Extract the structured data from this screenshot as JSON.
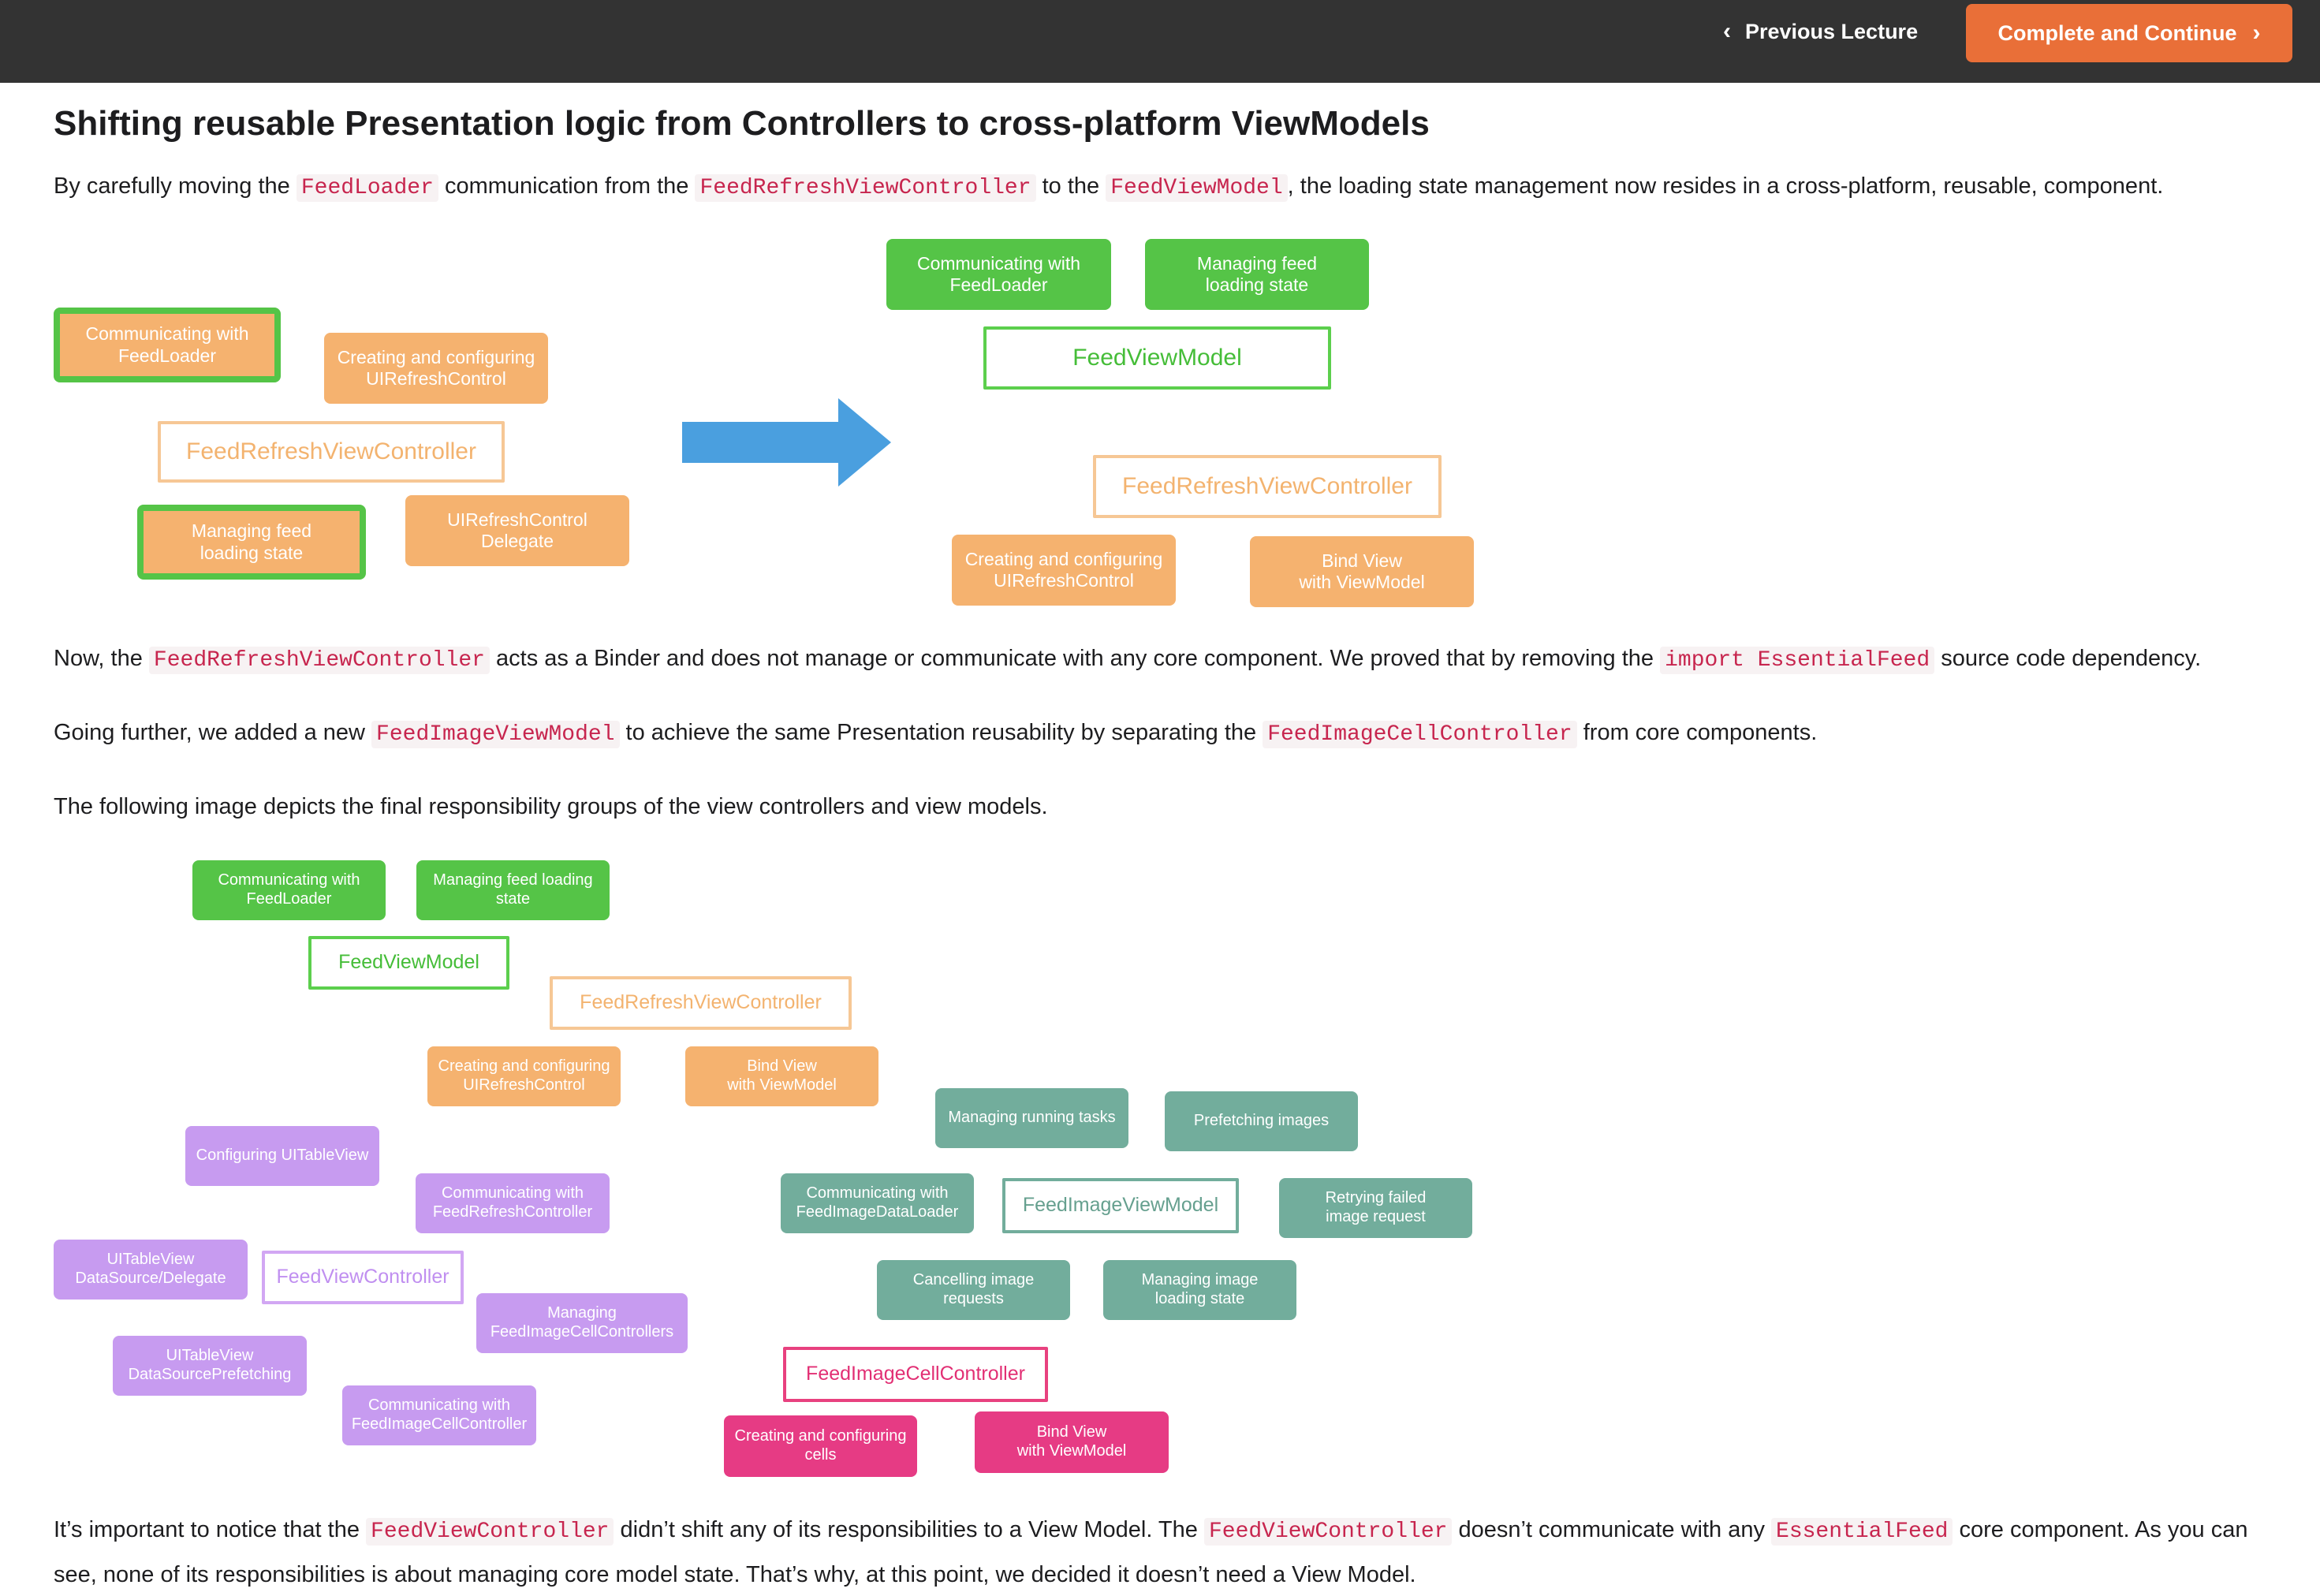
{
  "header": {
    "prev_label": "Previous Lecture",
    "complete_label": "Complete and Continue"
  },
  "article": {
    "title": "Shifting reusable Presentation logic from Controllers to cross-platform ViewModels",
    "p1": {
      "t1": "By carefully moving the ",
      "c1": "FeedLoader",
      "t2": " communication from the ",
      "c2": "FeedRefreshViewController",
      "t3": " to the ",
      "c3": "FeedViewModel",
      "t4": ", the loading state management now resides in a cross-platform, reusable, component."
    },
    "p2": {
      "t1": "Now, the ",
      "c1": "FeedRefreshViewController",
      "t2": " acts as a Binder and does not manage or communicate with any core component. We proved that by removing the ",
      "c2": "import EssentialFeed",
      "t3": " source code dependency."
    },
    "p3": {
      "t1": "Going further, we added a new ",
      "c1": "FeedImageViewModel",
      "t2": " to achieve the same Presentation reusability by separating the ",
      "c2": "FeedImageCellController",
      "t3": " from core components."
    },
    "p4": "The following image depicts the final responsibility groups of the view controllers and view models.",
    "p5": {
      "t1": "It’s important to notice that the ",
      "c1": "FeedViewController",
      "t2": " didn’t shift any of its responsibilities to a View Model. The ",
      "c2": "FeedViewController",
      "t3": " doesn’t communicate with any ",
      "c3": "EssentialFeed",
      "t4": " core component. As you can see, none of its responsibilities is about managing core model state. That’s why, at this point, we decided it doesn’t need a View Model."
    }
  },
  "diagram1": {
    "before": {
      "comm_loader": "Communicating with\nFeedLoader",
      "creating_refresh": "Creating and configuring\nUIRefreshControl",
      "controller": "FeedRefreshViewController",
      "managing_state": "Managing feed\nloading state",
      "refresh_delegate": "UIRefreshControl\nDelegate"
    },
    "after": {
      "comm_loader": "Communicating with\nFeedLoader",
      "managing_state": "Managing feed\nloading state",
      "viewmodel": "FeedViewModel",
      "controller": "FeedRefreshViewController",
      "creating_refresh": "Creating and configuring\nUIRefreshControl",
      "bind_view": "Bind View\nwith ViewModel"
    },
    "arrow_color": "#4a9fdf"
  },
  "diagram2": {
    "comm_loader": "Communicating with\nFeedLoader",
    "managing_state": "Managing feed loading\nstate",
    "feed_viewmodel": "FeedViewModel",
    "refresh_controller": "FeedRefreshViewController",
    "creating_refresh": "Creating and configuring\nUIRefreshControl",
    "bind_view": "Bind View\nwith ViewModel",
    "managing_tasks": "Managing running tasks",
    "prefetching": "Prefetching images",
    "configuring_table": "Configuring UITableView",
    "comm_refresh": "Communicating with\nFeedRefreshController",
    "comm_image_loader": "Communicating with\nFeedImageDataLoader",
    "image_viewmodel": "FeedImageViewModel",
    "retrying": "Retrying failed\nimage request",
    "table_datasource": "UITableView\nDataSource/Delegate",
    "feed_view_controller": "FeedViewController",
    "cancelling": "Cancelling image\nrequests",
    "managing_image_state": "Managing image\nloading state",
    "managing_cell_controllers": "Managing\nFeedImageCellControllers",
    "table_prefetching": "UITableView\nDataSourcePrefetching",
    "comm_cell_controller": "Communicating with\nFeedImageCellController",
    "cell_controller": "FeedImageCellController",
    "creating_cells": "Creating and configuring\ncells",
    "bind_view_cells": "Bind View\nwith ViewModel"
  },
  "colors": {
    "green": "#55c447",
    "orange": "#f5b26f",
    "teal": "#72ad9c",
    "purple": "#c79bf0",
    "pink": "#e63b84",
    "accent": "#e96f38",
    "code": "#c7254e"
  }
}
